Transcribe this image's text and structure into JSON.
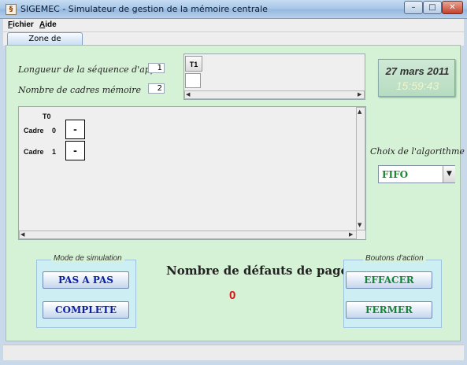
{
  "window": {
    "title": "SIGEMEC - Simulateur de gestion de la mémoire centrale",
    "icon_text": "§",
    "controls": {
      "minimize": "–",
      "maximize": "□",
      "close": "✕"
    }
  },
  "menu": {
    "items": [
      {
        "label": "Fichier"
      },
      {
        "label": "Aide"
      }
    ]
  },
  "tabs": [
    {
      "label": "Zone de simulation"
    }
  ],
  "params": {
    "seq_length_label": "Longueur de la séquence d'appel",
    "seq_length_value": "1",
    "frames_label": "Nombre de cadres mémoire",
    "frames_value": "2"
  },
  "sequence_table": {
    "header": "T1",
    "values": [
      ""
    ]
  },
  "clock": {
    "date": "27 mars 2011",
    "time": "15:59:43"
  },
  "frames_table": {
    "column_header": "T0",
    "rows": [
      {
        "label": "Cadre",
        "index": "0",
        "value": "-"
      },
      {
        "label": "Cadre",
        "index": "1",
        "value": "-"
      }
    ]
  },
  "algorithm": {
    "label": "Choix de l'algorithme",
    "selected": "FIFO"
  },
  "simulation_mode": {
    "title": "Mode de simulation",
    "step_button": "PAS A PAS",
    "complete_button": "COMPLETE"
  },
  "page_faults": {
    "label": "Nombre de défauts de page:",
    "count": "0"
  },
  "actions": {
    "title": "Boutons d'action",
    "clear_button": "EFFACER",
    "close_button": "FERMER"
  },
  "scroll_icons": {
    "left": "◀",
    "right": "▶",
    "up": "▲",
    "down": "▼"
  },
  "colors": {
    "panel": "#d6f2d6",
    "accent_blue": "#0b1fa8",
    "accent_green": "#138535",
    "fault_red": "#e01010"
  }
}
